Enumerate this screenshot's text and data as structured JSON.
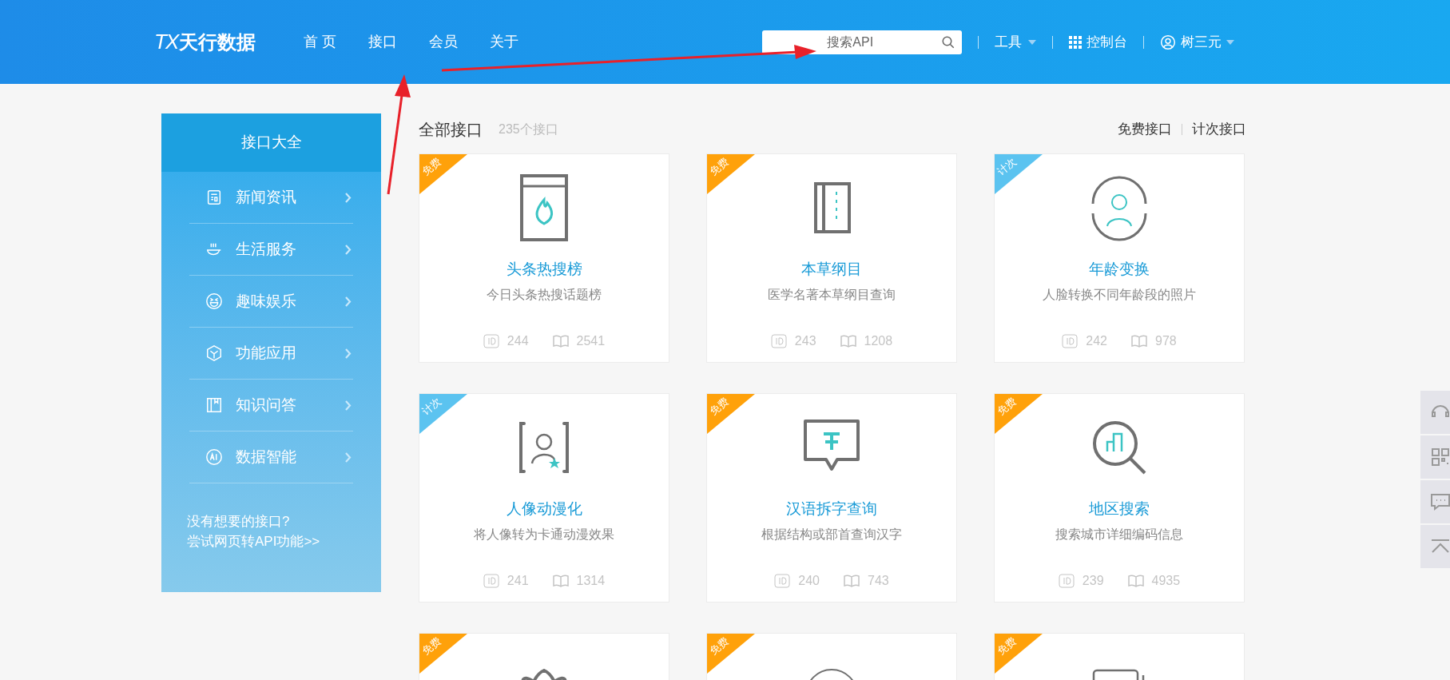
{
  "header": {
    "logo_mark": "TX",
    "logo_text": "天行数据",
    "nav": [
      "首 页",
      "接口",
      "会员",
      "关于"
    ],
    "search": {
      "placeholder": "搜索API"
    },
    "tools": "工具",
    "console": "控制台",
    "user": "树三元"
  },
  "sidebar": {
    "title": "接口大全",
    "items": [
      {
        "label": "新闻资讯"
      },
      {
        "label": "生活服务"
      },
      {
        "label": "趣味娱乐"
      },
      {
        "label": "功能应用"
      },
      {
        "label": "知识问答"
      },
      {
        "label": "数据智能"
      }
    ],
    "footer": [
      "没有想要的接口?",
      "尝试网页转API功能>>"
    ]
  },
  "content": {
    "title": "全部接口",
    "count": "235个接口",
    "filters": [
      "免费接口",
      "计次接口"
    ],
    "cards": [
      {
        "tag": {
          "text": "免费",
          "kind": "free"
        },
        "title": "头条热搜榜",
        "desc": "今日头条热搜话题榜",
        "id": "244",
        "reads": "2541"
      },
      {
        "tag": {
          "text": "免费",
          "kind": "free"
        },
        "title": "本草纲目",
        "desc": "医学名著本草纲目查询",
        "id": "243",
        "reads": "1208"
      },
      {
        "tag": {
          "text": "计次",
          "kind": "paid"
        },
        "title": "年龄变换",
        "desc": "人脸转换不同年龄段的照片",
        "id": "242",
        "reads": "978"
      },
      {
        "tag": {
          "text": "计次",
          "kind": "paid"
        },
        "title": "人像动漫化",
        "desc": "将人像转为卡通动漫效果",
        "id": "241",
        "reads": "1314"
      },
      {
        "tag": {
          "text": "免费",
          "kind": "free"
        },
        "title": "汉语拆字查询",
        "desc": "根据结构或部首查询汉字",
        "id": "240",
        "reads": "743"
      },
      {
        "tag": {
          "text": "免费",
          "kind": "free"
        },
        "title": "地区搜索",
        "desc": "搜索城市详细编码信息",
        "id": "239",
        "reads": "4935"
      },
      {
        "tag": {
          "text": "免费",
          "kind": "free"
        }
      },
      {
        "tag": {
          "text": "免费",
          "kind": "free"
        }
      },
      {
        "tag": {
          "text": "免费",
          "kind": "free"
        }
      }
    ]
  }
}
